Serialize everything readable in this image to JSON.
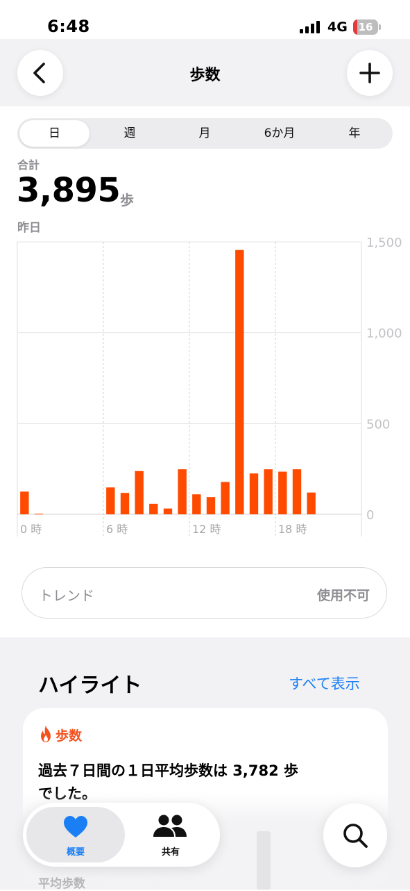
{
  "status_bar": {
    "time": "6:48",
    "network": "4G",
    "battery": "16",
    "battery_level": 0.16,
    "battery_color": "#e5393f"
  },
  "header": {
    "title": "歩数",
    "back_icon": "chevron-left-icon",
    "add_icon": "plus-icon"
  },
  "segments": {
    "items": [
      "日",
      "週",
      "月",
      "6か月",
      "年"
    ],
    "selected": "日"
  },
  "summary": {
    "label": "合計",
    "value": "3,895",
    "unit": "歩",
    "date": "昨日"
  },
  "chart_data": {
    "type": "bar",
    "x_ticks": [
      "0 時",
      "6 時",
      "12 時",
      "18 時"
    ],
    "x_tick_hours": [
      0,
      6,
      12,
      18
    ],
    "hours": [
      0,
      1,
      2,
      3,
      4,
      5,
      6,
      7,
      8,
      9,
      10,
      11,
      12,
      13,
      14,
      15,
      16,
      17,
      18,
      19
    ],
    "values": [
      125,
      3,
      0,
      0,
      0,
      0,
      148,
      118,
      238,
      58,
      32,
      248,
      110,
      95,
      178,
      1455,
      225,
      248,
      235,
      248
    ],
    "extra": {
      "hour": 20,
      "value": 120
    },
    "y_ticks": [
      0,
      500,
      1000,
      1500
    ],
    "y_tick_labels": [
      "0",
      "500",
      "1,000",
      "1,500"
    ],
    "ylim": [
      0,
      1500
    ],
    "xlim_hours": [
      0,
      24
    ],
    "bar_color": "#ff4b00",
    "grid": true
  },
  "trend": {
    "label": "トレンド",
    "status": "使用不可"
  },
  "highlights": {
    "title": "ハイライト",
    "show_all": "すべて表示",
    "card": {
      "category": "歩数",
      "category_icon": "flame-icon",
      "line1": "過去７日間の１日平均歩数は 3,782 歩",
      "line2": "でした。",
      "footer": "平均歩数"
    }
  },
  "tab_bar": {
    "overview": {
      "label": "概要",
      "icon": "heart-icon",
      "color": "#1a7ff5"
    },
    "sharing": {
      "label": "共有",
      "icon": "people-icon"
    },
    "search_icon": "search-icon"
  }
}
